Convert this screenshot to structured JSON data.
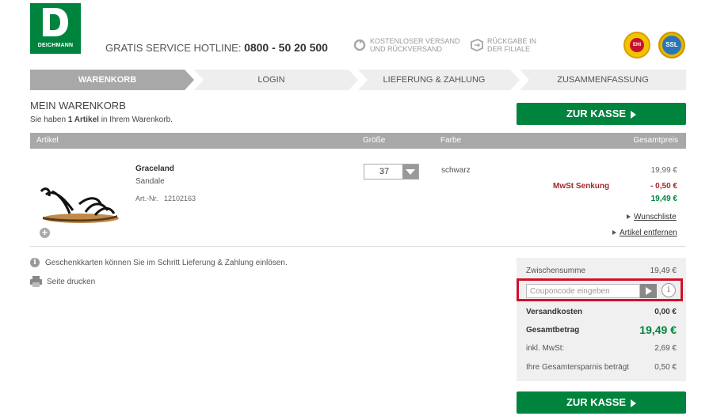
{
  "header": {
    "brand": "DEICHMANN",
    "hotline_label": "GRATIS SERVICE HOTLINE:",
    "hotline_number": "0800 - 50 20 500",
    "service1": [
      "KOSTENLOSER VERSAND",
      "UND RÜCKVERSAND"
    ],
    "service2": [
      "RÜCKGABE IN",
      "DER FILIALE"
    ],
    "seal1": "EHI",
    "seal2": "SSL"
  },
  "steps": [
    "WARENKORB",
    "LOGIN",
    "LIEFERUNG & ZAHLUNG",
    "ZUSAMMENFASSUNG"
  ],
  "cart": {
    "title": "MEIN WARENKORB",
    "subtitle_pre": "Sie haben ",
    "subtitle_count": "1 Artikel",
    "subtitle_post": " in Ihrem Warenkorb.",
    "checkout_label": "ZUR KASSE"
  },
  "table_header": {
    "article": "Artikel",
    "size": "Größe",
    "color": "Farbe",
    "total": "Gesamtpreis"
  },
  "item": {
    "name": "Graceland",
    "type": "Sandale",
    "artnr_label": "Art.-Nr.",
    "artnr": "12102163",
    "size": "37",
    "color": "schwarz",
    "price_original": "19,99 €",
    "discount_label": "MwSt Senkung",
    "discount": "- 0,50 €",
    "price_final": "19,49 €",
    "wishlist_link": "Wunschliste",
    "remove_link": "Artikel entfernen"
  },
  "info": {
    "gift_cards": "Geschenkkarten können Sie im Schritt Lieferung & Zahlung einlösen.",
    "print": "Seite drucken"
  },
  "summary": {
    "subtotal_label": "Zwischensumme",
    "subtotal": "19,49 €",
    "coupon_placeholder": "Couponcode eingeben",
    "shipping_label": "Versandkosten",
    "shipping": "0,00 €",
    "total_label": "Gesamtbetrag",
    "total": "19,49 €",
    "vat_label": "inkl. MwSt:",
    "vat": "2,69 €",
    "savings_label": "Ihre Gesamtersparnis beträgt",
    "savings": "0,50 €"
  },
  "colors": {
    "brand_green": "#00833d",
    "discount_red": "#a3282c",
    "highlight_red": "#d0102a",
    "step_active": "#a8a8a8"
  }
}
